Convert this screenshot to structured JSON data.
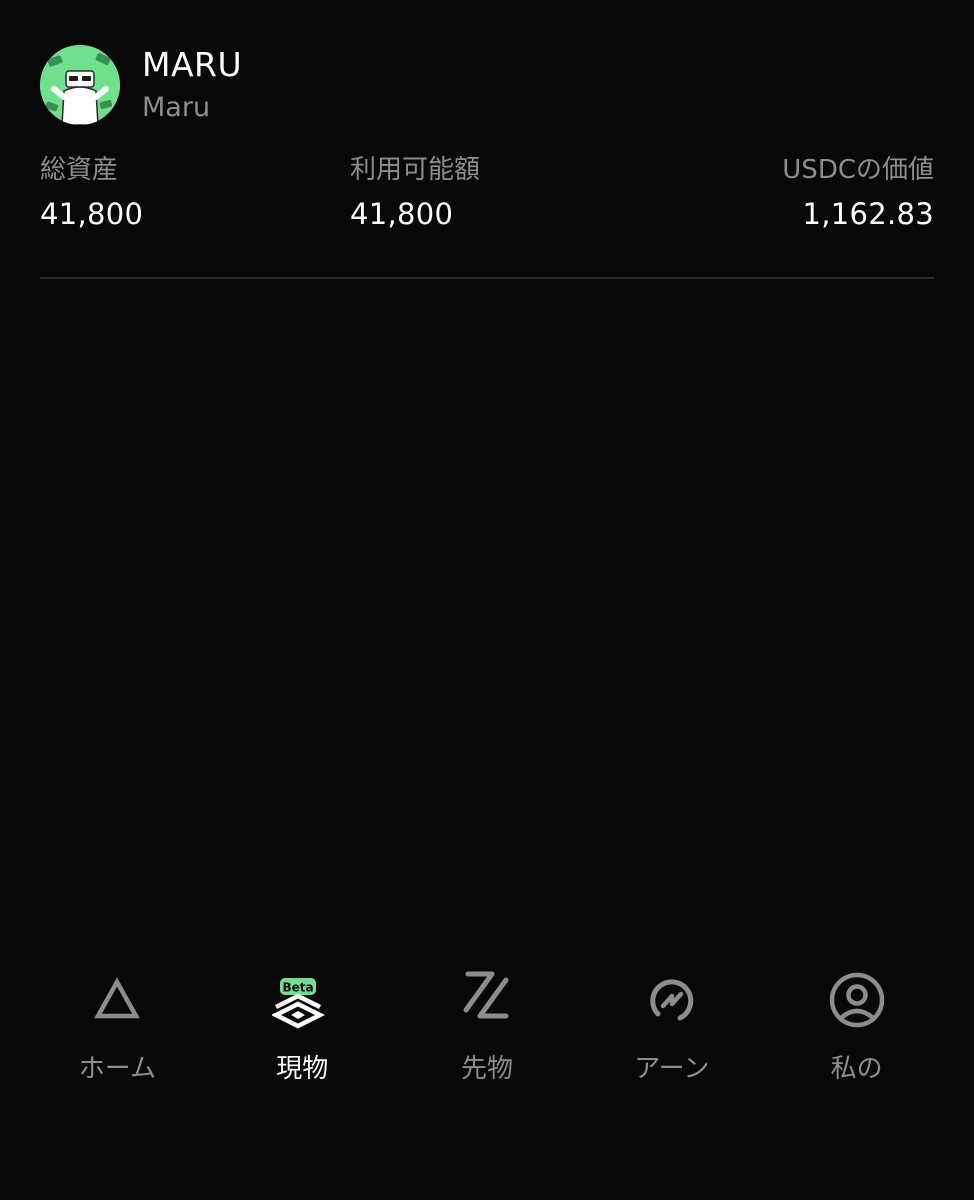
{
  "profile": {
    "display_name": "MARU",
    "username": "Maru",
    "avatar_icon": "cartoon-avatar",
    "avatar_bg": "#6fe08c"
  },
  "stats": [
    {
      "label": "総資産",
      "value": "41,800"
    },
    {
      "label": "利用可能額",
      "value": "41,800"
    },
    {
      "label": "USDCの価値",
      "value": "1,162.83"
    }
  ],
  "nav": {
    "items": [
      {
        "label": "ホーム",
        "icon": "triangle-icon",
        "active": false
      },
      {
        "label": "現物",
        "icon": "layers-icon",
        "badge": "Beta",
        "active": true
      },
      {
        "label": "先物",
        "icon": "futures-z-icon",
        "active": false
      },
      {
        "label": "アーン",
        "icon": "earn-icon",
        "active": false
      },
      {
        "label": "私の",
        "icon": "user-circle-icon",
        "active": false
      }
    ]
  },
  "colors": {
    "background": "#080808",
    "text_primary": "#ffffff",
    "text_secondary": "#8d8d8d",
    "accent": "#6fe08c"
  }
}
